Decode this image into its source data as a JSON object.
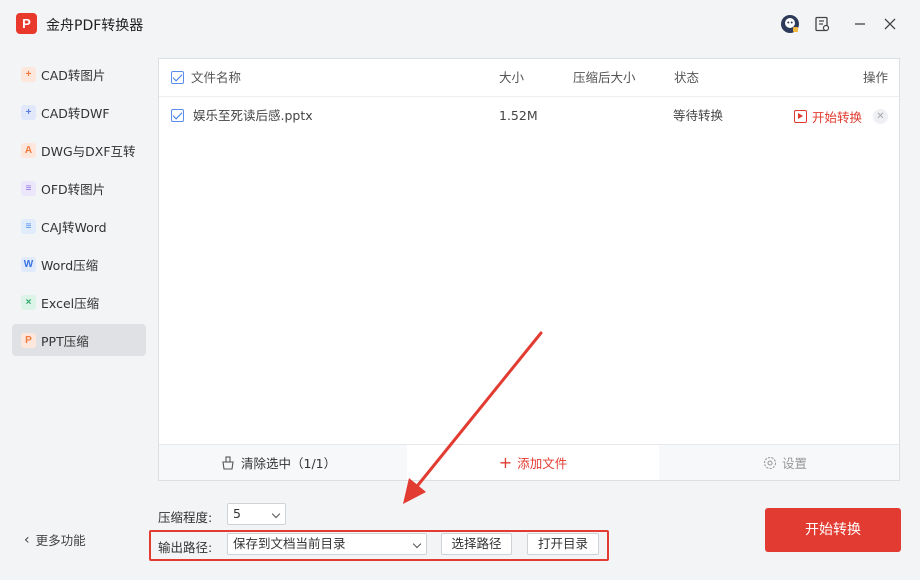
{
  "app": {
    "logo_text": "P",
    "title": "金舟PDF转换器"
  },
  "titlebar": {
    "icons": [
      "user-avatar-icon",
      "feedback-icon",
      "minimize-icon",
      "close-icon"
    ]
  },
  "sidebar": {
    "items": [
      {
        "label": "CAD转图片",
        "icon": "cad-image-icon",
        "icon_glyph": "+",
        "color": "#f07a3e",
        "bg": "#fde7dc"
      },
      {
        "label": "CAD转DWF",
        "icon": "cad-dwf-icon",
        "icon_glyph": "+",
        "color": "#5c7fe3",
        "bg": "#e1e8fb"
      },
      {
        "label": "DWG与DXF互转",
        "icon": "dwg-dxf-icon",
        "icon_glyph": "A",
        "color": "#f07a3e",
        "bg": "#fde7dc"
      },
      {
        "label": "OFD转图片",
        "icon": "ofd-image-icon",
        "icon_glyph": "≡",
        "color": "#8a6fe0",
        "bg": "#ece6fb"
      },
      {
        "label": "CAJ转Word",
        "icon": "caj-word-icon",
        "icon_glyph": "≡",
        "color": "#4d8ee6",
        "bg": "#e0ecfb"
      },
      {
        "label": "Word压缩",
        "icon": "word-compress-icon",
        "icon_glyph": "W",
        "color": "#3a74e0",
        "bg": "#e0eafb"
      },
      {
        "label": "Excel压缩",
        "icon": "excel-compress-icon",
        "icon_glyph": "×",
        "color": "#2fa86a",
        "bg": "#dcf3e7"
      },
      {
        "label": "PPT压缩",
        "icon": "ppt-compress-icon",
        "icon_glyph": "P",
        "color": "#f07a3e",
        "bg": "#fde7dc",
        "active": true
      }
    ],
    "more_label": "更多功能"
  },
  "table": {
    "headers": {
      "name": "文件名称",
      "size": "大小",
      "compressed_size": "压缩后大小",
      "status": "状态",
      "action": "操作"
    },
    "rows": [
      {
        "name": "娱乐至死读后感.pptx",
        "size": "1.52M",
        "compressed_size": "",
        "status": "等待转换",
        "action": "开始转换"
      }
    ]
  },
  "panel_footer": {
    "clear_label": "清除选中（1/1）",
    "add_label": "添加文件",
    "settings_label": "设置"
  },
  "options": {
    "compress_label": "压缩程度:",
    "compress_value": "5",
    "output_label": "输出路径:",
    "output_value": "保存到文档当前目录",
    "choose_path_label": "选择路径",
    "open_dir_label": "打开目录"
  },
  "convert_button": "开始转换",
  "colors": {
    "accent": "#e23b31",
    "checkbox": "#3a78e7"
  }
}
